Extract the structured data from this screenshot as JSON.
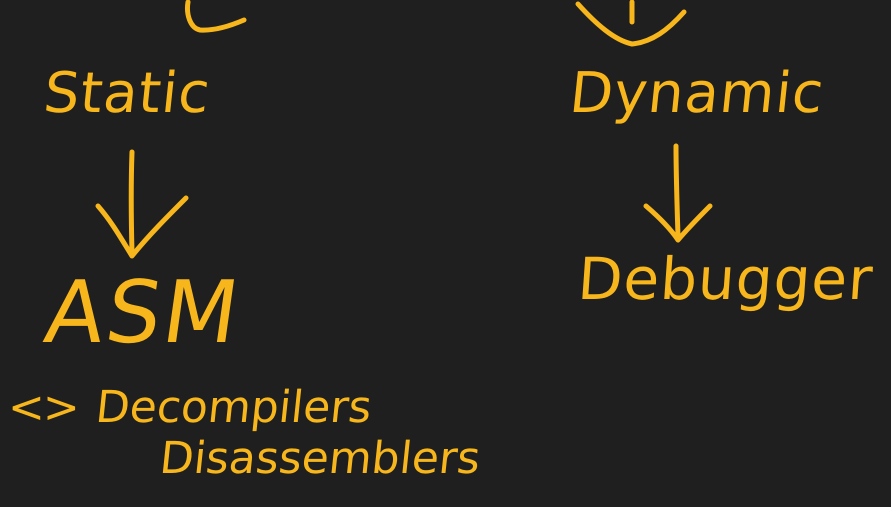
{
  "diagram": {
    "ink_color": "#f7b61c",
    "background_color": "#1f1f1f",
    "left_branch": {
      "label": "Static",
      "tool": "ASM",
      "bullet_mark": "<>",
      "tool_types": [
        "Decompilers",
        "Disassemblers"
      ]
    },
    "right_branch": {
      "label": "Dynamic",
      "tool": "Debugger"
    }
  }
}
